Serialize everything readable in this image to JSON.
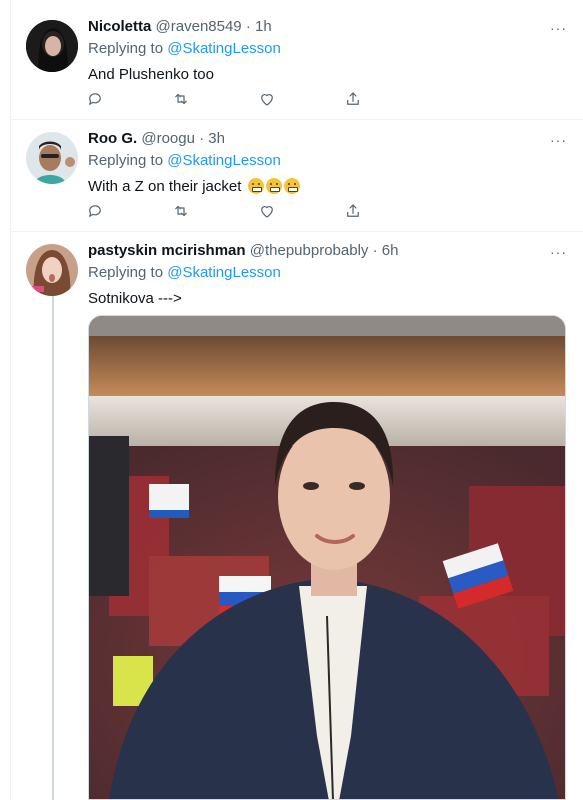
{
  "tweets": [
    {
      "name": "Nicoletta",
      "handle": "@raven8549",
      "time": "· 1h",
      "replying_prefix": "Replying to ",
      "replying_to": "@SkatingLesson",
      "text": "And Plushenko too"
    },
    {
      "name": "Roo G.",
      "handle": "@roogu",
      "time": "· 3h",
      "replying_prefix": "Replying to ",
      "replying_to": "@SkatingLesson",
      "text": "With a Z on their jacket"
    },
    {
      "name": "pastyskin mcirishman",
      "handle": "@thepubprobably",
      "time": "· 6h",
      "replying_prefix": "Replying to ",
      "replying_to": "@SkatingLesson",
      "text": "Sotnikova --->"
    }
  ],
  "icons": {
    "more": "more-icon",
    "reply": "reply-icon",
    "retweet": "retweet-icon",
    "like": "heart-icon",
    "share": "share-icon"
  },
  "more_glyph": "···",
  "colors": {
    "mention": "#1d9bf0",
    "muted": "#536471",
    "text": "#0f1419",
    "divider": "#eff3f4"
  }
}
